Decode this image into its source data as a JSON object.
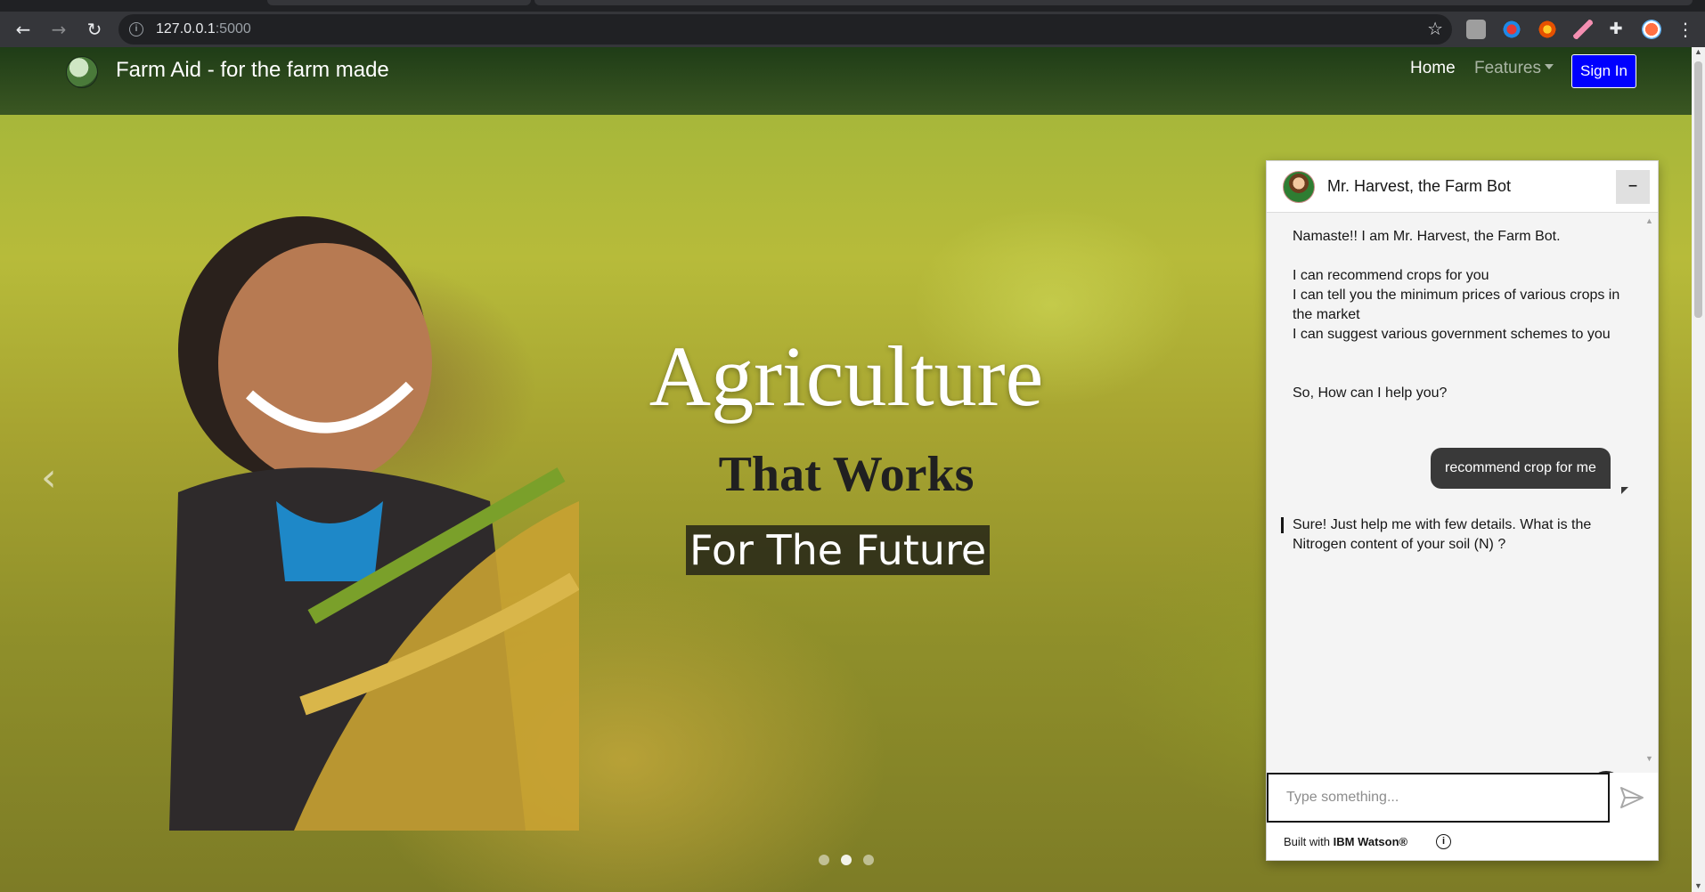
{
  "browser": {
    "url_host": "127.0.0.1",
    "url_port": ":5000",
    "icons": [
      "back-arrow-icon",
      "forward-arrow-icon",
      "reload-icon",
      "site-info-icon",
      "bookmark-star-icon",
      "extensions-puzzle-icon",
      "profile-avatar-icon",
      "kebab-menu-icon"
    ]
  },
  "navbar": {
    "brand": "Farm Aid - for the farm made",
    "links": {
      "home": "Home",
      "features": "Features"
    },
    "signin": "Sign In"
  },
  "hero": {
    "title": "Agriculture",
    "subtitle": "That Works",
    "tagline": "For The Future",
    "prev_glyph": "‹"
  },
  "chat": {
    "title": "Mr. Harvest, the Farm Bot",
    "minimize_glyph": "–",
    "welcome": {
      "greeting": "Namaste!! I am Mr. Harvest, the Farm Bot.",
      "capabilities": [
        "I can recommend crops for you",
        "I can tell you the minimum prices of various crops in the market",
        "I can suggest various government schemes to you"
      ],
      "question": "So, How can I help you?"
    },
    "user_message": "recommend crop for me",
    "bot_reply": "Sure! Just help me with few details. What is the Nitrogen content of your soil (N) ?",
    "help_glyph": "?",
    "input_placeholder": "Type something...",
    "footer_prefix": "Built with ",
    "footer_brand": "IBM Watson®",
    "info_glyph": "i"
  },
  "colors": {
    "signin_bg": "#0000ff",
    "user_bubble": "#393939",
    "chat_bg": "#f4f4f4"
  }
}
